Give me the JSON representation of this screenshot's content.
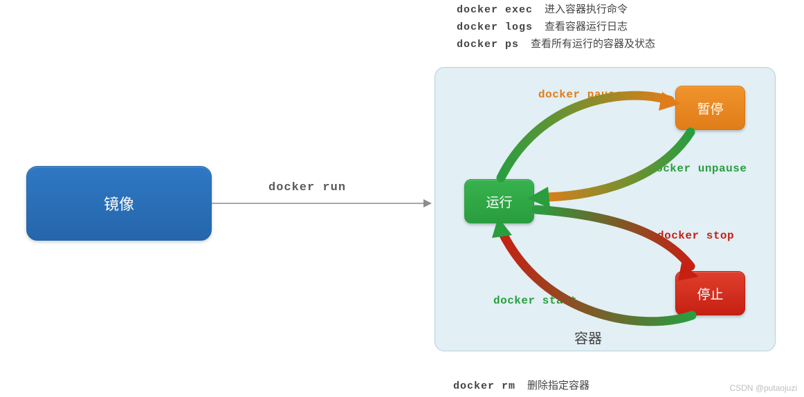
{
  "commands": {
    "exec": {
      "cmd": "docker exec",
      "desc": "进入容器执行命令"
    },
    "logs": {
      "cmd": "docker logs",
      "desc": "查看容器运行日志"
    },
    "ps": {
      "cmd": "docker ps",
      "desc": "查看所有运行的容器及状态"
    },
    "run": {
      "cmd": "docker run"
    },
    "pause": {
      "cmd": "docker pause"
    },
    "unpause": {
      "cmd": "docker unpause"
    },
    "stop": {
      "cmd": "docker stop"
    },
    "start": {
      "cmd": "docker start"
    },
    "rm": {
      "cmd": "docker rm",
      "desc": "删除指定容器"
    }
  },
  "nodes": {
    "image": "镜像",
    "running": "运行",
    "paused": "暂停",
    "stopped": "停止",
    "container": "容器"
  },
  "watermark": "CSDN @putaojuzi",
  "colors": {
    "green": "#2a9d3f",
    "orange": "#e07d19",
    "red": "#c62013",
    "blue": "#2566ab"
  }
}
